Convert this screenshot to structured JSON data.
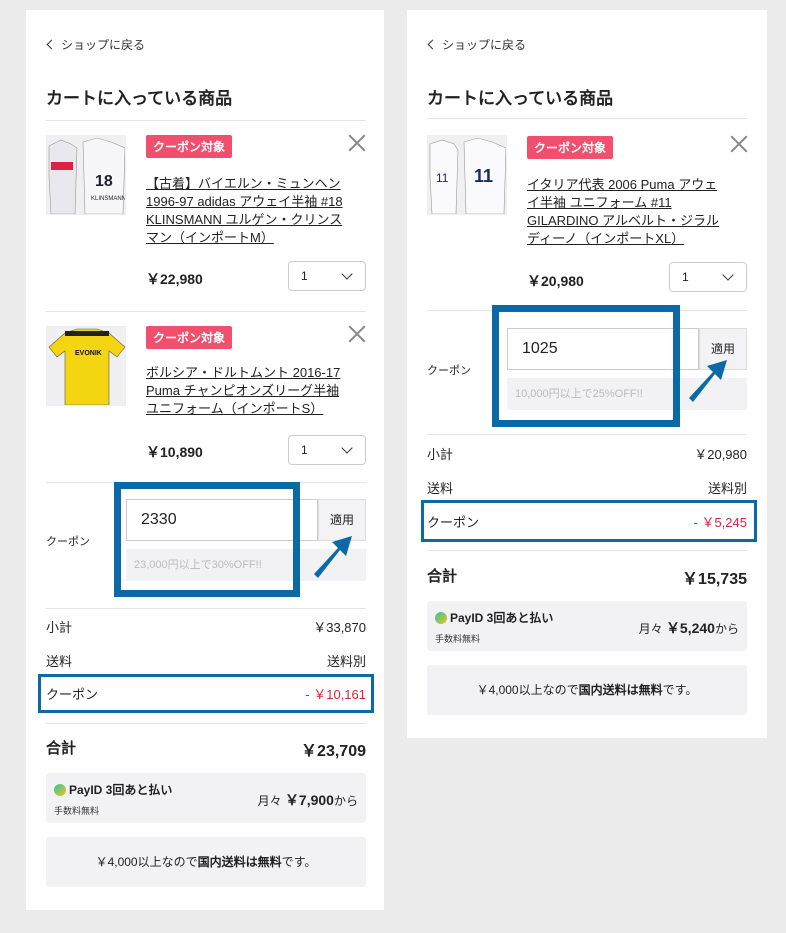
{
  "left": {
    "back_label": "ショップに戻る",
    "title": "カートに入っている商品",
    "items": [
      {
        "badge": "クーポン対象",
        "name": "【古着】バイエルン・ミュンヘン 1996-97 adidas アウェイ半袖 #18 KLINSMANN ユルゲン・クリンスマン（インポートM）",
        "price": "￥22,980",
        "qty": "1"
      },
      {
        "badge": "クーポン対象",
        "name": "ボルシア・ドルトムント 2016-17 Puma チャンピオンズリーグ半袖 ユニフォーム（インポートS）",
        "price": "￥10,890",
        "qty": "1"
      }
    ],
    "coupon": {
      "label": "クーポン",
      "code": "2330",
      "apply": "適用",
      "note": "23,000円以上で30%OFF!!"
    },
    "summary": {
      "subtotal_label": "小計",
      "subtotal": "￥33,870",
      "shipping_label": "送料",
      "shipping": "送料別",
      "coupon_label": "クーポン",
      "coupon_discount": "- ￥10,161"
    },
    "total_label": "合計",
    "total": "￥23,709",
    "payid": {
      "logo": "PayID 3回あと払い",
      "fee": "手数料無料",
      "monthly_prefix": "月々",
      "monthly": "￥7,900",
      "monthly_suffix": "から"
    },
    "shipping_note": {
      "pre": "￥4,000以上なので",
      "bold": "国内送料は無料",
      "post": "です。"
    }
  },
  "right": {
    "back_label": "ショップに戻る",
    "title": "カートに入っている商品",
    "items": [
      {
        "badge": "クーポン対象",
        "name": "イタリア代表 2006 Puma アウェイ半袖 ユニフォーム #11 GILARDINO アルベルト・ジラルディーノ（インポートXL）",
        "price": "￥20,980",
        "qty": "1"
      }
    ],
    "coupon": {
      "label": "クーポン",
      "code": "1025",
      "apply": "適用",
      "note": "10,000円以上で25%OFF!!"
    },
    "summary": {
      "subtotal_label": "小計",
      "subtotal": "￥20,980",
      "shipping_label": "送料",
      "shipping": "送料別",
      "coupon_label": "クーポン",
      "coupon_discount": "- ￥5,245"
    },
    "total_label": "合計",
    "total": "￥15,735",
    "payid": {
      "logo": "PayID 3回あと払い",
      "fee": "手数料無料",
      "monthly_prefix": "月々",
      "monthly": "￥5,240",
      "monthly_suffix": "から"
    },
    "shipping_note": {
      "pre": "￥4,000以上なので",
      "bold": "国内送料は無料",
      "post": "です。"
    }
  },
  "colors": {
    "badge": "#f0506e",
    "highlight": "#0b6aa5",
    "discount": "#d9233b"
  }
}
